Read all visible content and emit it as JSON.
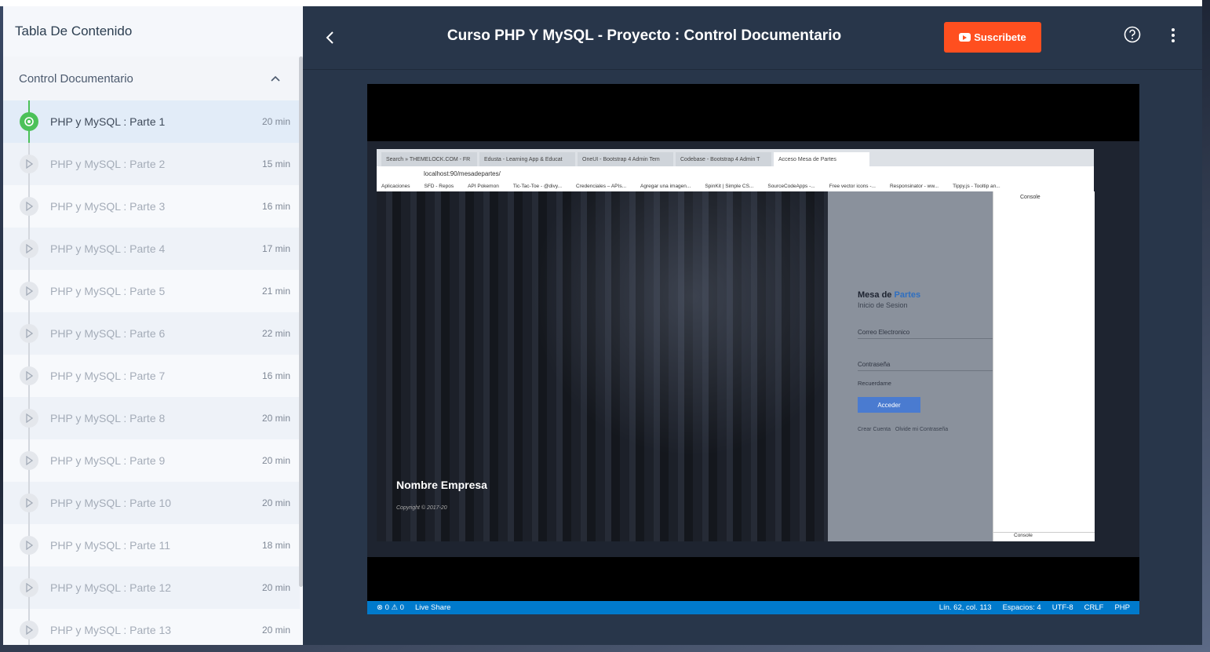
{
  "sidebar": {
    "title": "Tabla De Contenido",
    "section_title": "Control Documentario",
    "lessons": [
      {
        "name": "PHP y MySQL : Parte 1",
        "duration": "20 min"
      },
      {
        "name": "PHP y MySQL : Parte 2",
        "duration": "15 min"
      },
      {
        "name": "PHP y MySQL : Parte 3",
        "duration": "16 min"
      },
      {
        "name": "PHP y MySQL : Parte 4",
        "duration": "17 min"
      },
      {
        "name": "PHP y MySQL : Parte 5",
        "duration": "21 min"
      },
      {
        "name": "PHP y MySQL : Parte 6",
        "duration": "22 min"
      },
      {
        "name": "PHP y MySQL : Parte 7",
        "duration": "16 min"
      },
      {
        "name": "PHP y MySQL : Parte 8",
        "duration": "20 min"
      },
      {
        "name": "PHP y MySQL : Parte 9",
        "duration": "20 min"
      },
      {
        "name": "PHP y MySQL : Parte 10",
        "duration": "20 min"
      },
      {
        "name": "PHP y MySQL : Parte 11",
        "duration": "18 min"
      },
      {
        "name": "PHP y MySQL : Parte 12",
        "duration": "20 min"
      },
      {
        "name": "PHP y MySQL : Parte 13",
        "duration": "20 min"
      }
    ]
  },
  "header": {
    "title": "Curso PHP Y MySQL - Proyecto : Control Documentario",
    "subscribe_label": "Suscribete"
  },
  "video": {
    "browser_tabs": [
      "Search » THEMELOCK.COM - FR",
      "Edusta - Learning App & Educat",
      "OneUI - Bootstrap 4 Admin Tem",
      "Codebase - Bootstrap 4 Admin T",
      "Acceso Mesa de Partes"
    ],
    "address": "localhost:90/mesadepartes/",
    "bookmarks": [
      "Aplicaciones",
      "SFD - Repos",
      "API Pokemon",
      "Tic-Tac-Toe - @divy...",
      "Credenciales – APIs...",
      "Agregar una imagen...",
      "SpinKit | Simple CS...",
      "SourceCodeApps -...",
      "Free vector icons -...",
      "Responsinator - ww...",
      "Tippy.js - Tooltip an..."
    ],
    "company_name": "Nombre Empresa",
    "copyright": "Copyright © 2017-20",
    "login_title_a": "Mesa de",
    "login_title_b": "Partes",
    "login_subtitle": "Inicio de Sesion",
    "email_label": "Correo Electronico",
    "password_label": "Contraseña",
    "remember_label": "Recuerdame",
    "login_button": "Acceder",
    "create_account": "Crear Cuenta",
    "forgot_password": "Olvide mi Contraseña",
    "devtools_tab": "Console",
    "devtools_bottom": "Console",
    "status_left": [
      "⊗ 0 ⚠ 0",
      "Live Share"
    ],
    "status_right": [
      "Lín. 62, col. 113",
      "Espacios: 4",
      "UTF-8",
      "CRLF",
      "PHP"
    ]
  },
  "colors": {
    "accent_green": "#4cc159",
    "subscribe": "#ff4f1f",
    "main_bg": "#28364a",
    "status_blue": "#007acc"
  }
}
